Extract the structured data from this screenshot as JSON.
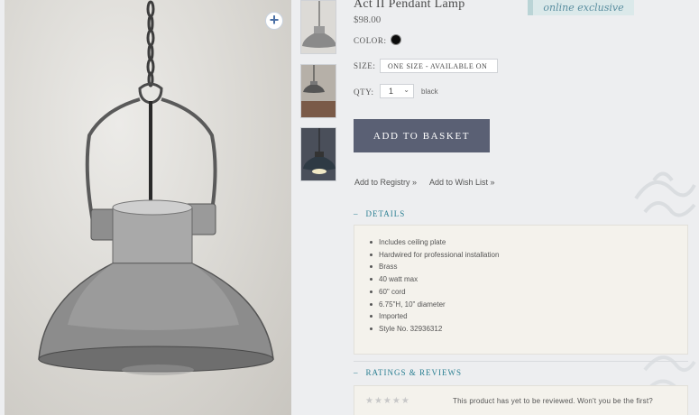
{
  "product": {
    "title": "Act II Pendant Lamp",
    "price": "$98.00",
    "badge": "online exclusive"
  },
  "options": {
    "color_label": "COLOR:",
    "color_swatch": "#0b0b0b",
    "size_label": "SIZE:",
    "size_value": "ONE SIZE - AVAILABLE ON",
    "qty_label": "QTY:",
    "qty_value": "1",
    "color_name": "black"
  },
  "actions": {
    "add_to_basket": "ADD TO BASKET",
    "add_to_registry": "Add to Registry »",
    "add_to_wish_list": "Add to Wish List »"
  },
  "details": {
    "heading": "DETAILS",
    "items": [
      "Includes ceiling plate",
      "Hardwired for professional installation",
      "Brass",
      "40 watt max",
      "60\" cord",
      "6.75\"H, 10\" diameter",
      "Imported",
      "Style No. 32936312"
    ]
  },
  "reviews": {
    "heading": "RATINGS & REVIEWS",
    "stars": "★★★★★",
    "empty_text": "This product has yet to be reviewed. Won't you be the first?"
  },
  "icons": {
    "zoom": "plus-icon",
    "collapse": "minus-icon",
    "qty_chevron": "chevron-down-icon"
  },
  "colors": {
    "button": "#5a6074",
    "accent": "#2a7f92",
    "badge": "#dbe9ea"
  }
}
